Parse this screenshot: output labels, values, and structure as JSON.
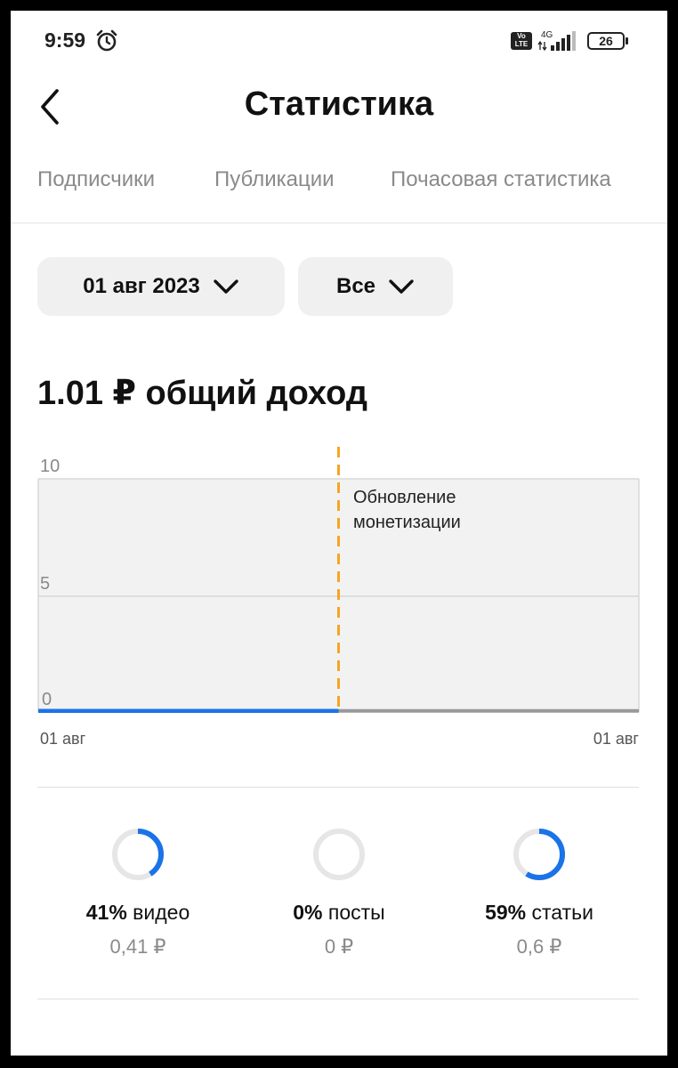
{
  "status_bar": {
    "time": "9:59",
    "network": "4G",
    "volte_line1": "Vo",
    "volte_line2": "LTE",
    "battery": "26"
  },
  "header": {
    "title": "Статистика"
  },
  "tabs": [
    {
      "label": "Подписчики"
    },
    {
      "label": "Публикации"
    },
    {
      "label": "Почасовая статистика"
    }
  ],
  "filters": {
    "date": "01 авг 2023",
    "type": "Все"
  },
  "total_income": "1.01 ₽ общий доход",
  "chart_data": {
    "type": "area",
    "y_ticks": [
      "10",
      "5",
      "0"
    ],
    "ylim": [
      0,
      10
    ],
    "x_labels": [
      "01 авг",
      "01 авг"
    ],
    "annotation": {
      "label_line1": "Обновление",
      "label_line2": "монетизации",
      "position": "middle"
    },
    "series": [
      {
        "color": "#1a73e8",
        "values": [
          0.05,
          0.05
        ]
      },
      {
        "color": "#999999",
        "values": [
          0.05,
          0.05
        ]
      }
    ],
    "grid": true
  },
  "breakdown": [
    {
      "percent": "41%",
      "label": "видео",
      "amount": "0,41 ₽",
      "fraction": 0.41
    },
    {
      "percent": "0%",
      "label": "посты",
      "amount": "0 ₽",
      "fraction": 0
    },
    {
      "percent": "59%",
      "label": "статьи",
      "amount": "0,6 ₽",
      "fraction": 0.59
    }
  ],
  "colors": {
    "accent": "#1a73e8",
    "annotation": "#f5a623",
    "ring_track": "#e6e6e6"
  }
}
